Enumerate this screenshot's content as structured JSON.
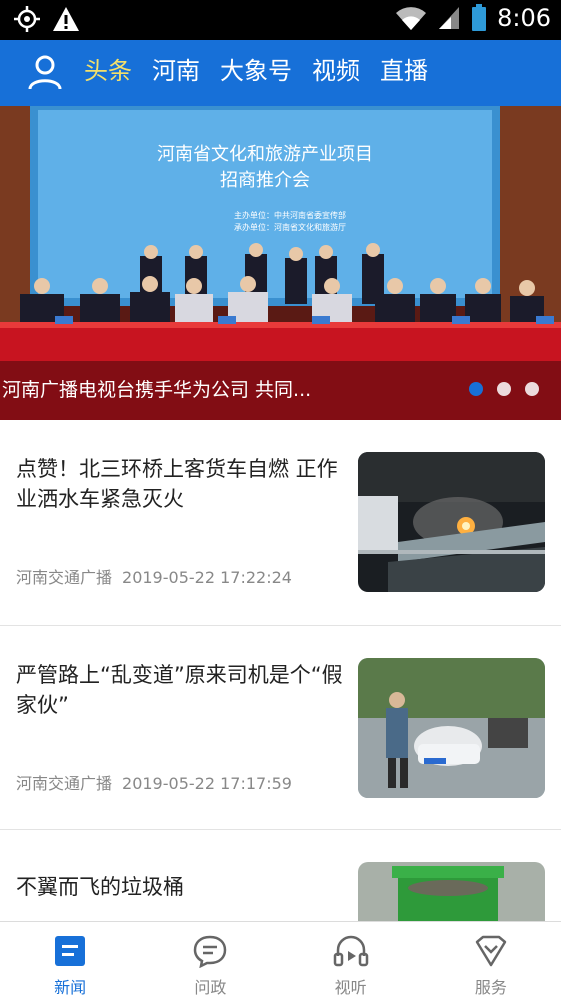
{
  "status_bar": {
    "time": "8:06"
  },
  "header": {
    "tabs": [
      {
        "label": "头条",
        "active": true
      },
      {
        "label": "河南",
        "active": false
      },
      {
        "label": "大象号",
        "active": false
      },
      {
        "label": "视频",
        "active": false
      },
      {
        "label": "直播",
        "active": false
      }
    ]
  },
  "banner": {
    "caption": "河南广播电视台携手华为公司 共同...",
    "screen_title_line1": "河南省文化和旅游产业项目",
    "screen_title_line2": "招商推介会",
    "screen_host": "主办单位：中共河南省委宣传部",
    "screen_organizer": "承办单位：河南省文化和旅游厅",
    "slide_count": 3,
    "active_slide": 1
  },
  "feed": {
    "items": [
      {
        "title": "点赞！北三环桥上客货车自燃 正作业洒水车紧急灭火",
        "source": "河南交通广播",
        "time": "2019-05-22 17:22:24"
      },
      {
        "title": "严管路上“乱变道”原来司机是个“假家伙”",
        "source": "河南交通广播",
        "time": "2019-05-22 17:17:59"
      },
      {
        "title": "不翼而飞的垃圾桶",
        "source": "",
        "time": ""
      }
    ]
  },
  "tabbar": {
    "items": [
      {
        "label": "新闻",
        "icon": "news-icon",
        "active": true
      },
      {
        "label": "问政",
        "icon": "chat-icon",
        "active": false
      },
      {
        "label": "视听",
        "icon": "audio-video-icon",
        "active": false
      },
      {
        "label": "服务",
        "icon": "service-icon",
        "active": false
      }
    ]
  },
  "colors": {
    "brand": "#1770d8",
    "active_tab": "#f4e06b"
  }
}
